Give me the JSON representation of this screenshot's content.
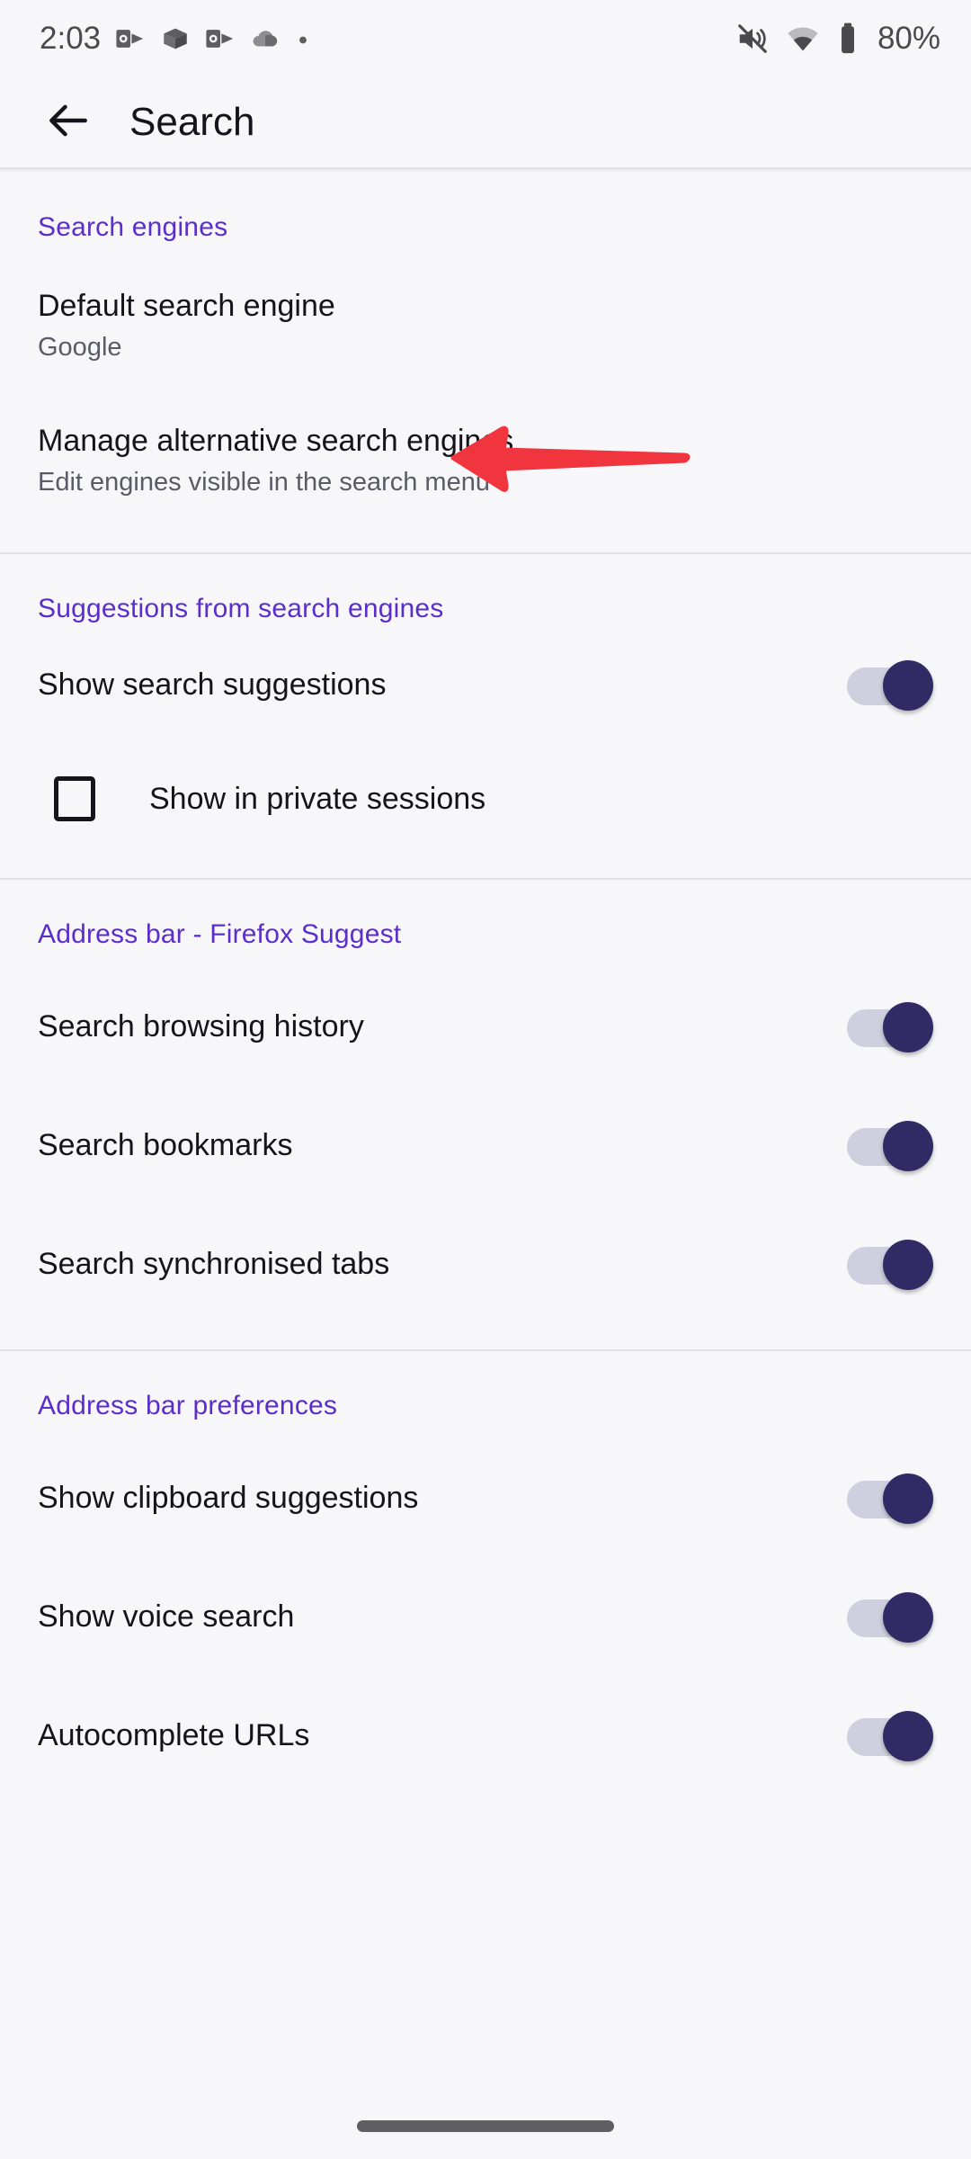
{
  "status_bar": {
    "time": "2:03",
    "battery_text": "80%",
    "left_icons": [
      "outlook-icon",
      "onedrive-box-icon",
      "outlook-icon",
      "weather-cloud-icon",
      "dot-icon"
    ],
    "right_icons": [
      "volume-muted-icon",
      "wifi-icon",
      "battery-icon"
    ]
  },
  "app_bar": {
    "back_icon": "back-arrow-icon",
    "title": "Search"
  },
  "colors": {
    "section_header": "#5b2ecc",
    "toggle_thumb_on": "#312a65",
    "toggle_track_on": "#cfcfe0",
    "annotation_arrow": "#f0353f",
    "background": "#f7f7fa",
    "primary_text": "#15141a",
    "secondary_text": "#5b5b66"
  },
  "annotation": {
    "type": "arrow",
    "direction": "left",
    "color": "#f0353f",
    "points_at": "Default search engine"
  },
  "sections": [
    {
      "header": "Search engines",
      "rows": [
        {
          "title": "Default search engine",
          "summary": "Google",
          "control": "none"
        },
        {
          "title": "Manage alternative search engines",
          "summary": "Edit engines visible in the search menu",
          "control": "none"
        }
      ]
    },
    {
      "header": "Suggestions from search engines",
      "rows": [
        {
          "title": "Show search suggestions",
          "summary": "",
          "control": "switch",
          "checked": true
        },
        {
          "title": "Show in private sessions",
          "summary": "",
          "control": "checkbox",
          "checked": false
        }
      ]
    },
    {
      "header": "Address bar - Firefox Suggest",
      "rows": [
        {
          "title": "Search browsing history",
          "summary": "",
          "control": "switch",
          "checked": true
        },
        {
          "title": "Search bookmarks",
          "summary": "",
          "control": "switch",
          "checked": true
        },
        {
          "title": "Search synchronised tabs",
          "summary": "",
          "control": "switch",
          "checked": true
        }
      ]
    },
    {
      "header": "Address bar preferences",
      "rows": [
        {
          "title": "Show clipboard suggestions",
          "summary": "",
          "control": "switch",
          "checked": true
        },
        {
          "title": "Show voice search",
          "summary": "",
          "control": "switch",
          "checked": true
        },
        {
          "title": "Autocomplete URLs",
          "summary": "",
          "control": "switch",
          "checked": true
        }
      ]
    }
  ],
  "nav_bar": {
    "handle": "home-gesture-pill"
  }
}
